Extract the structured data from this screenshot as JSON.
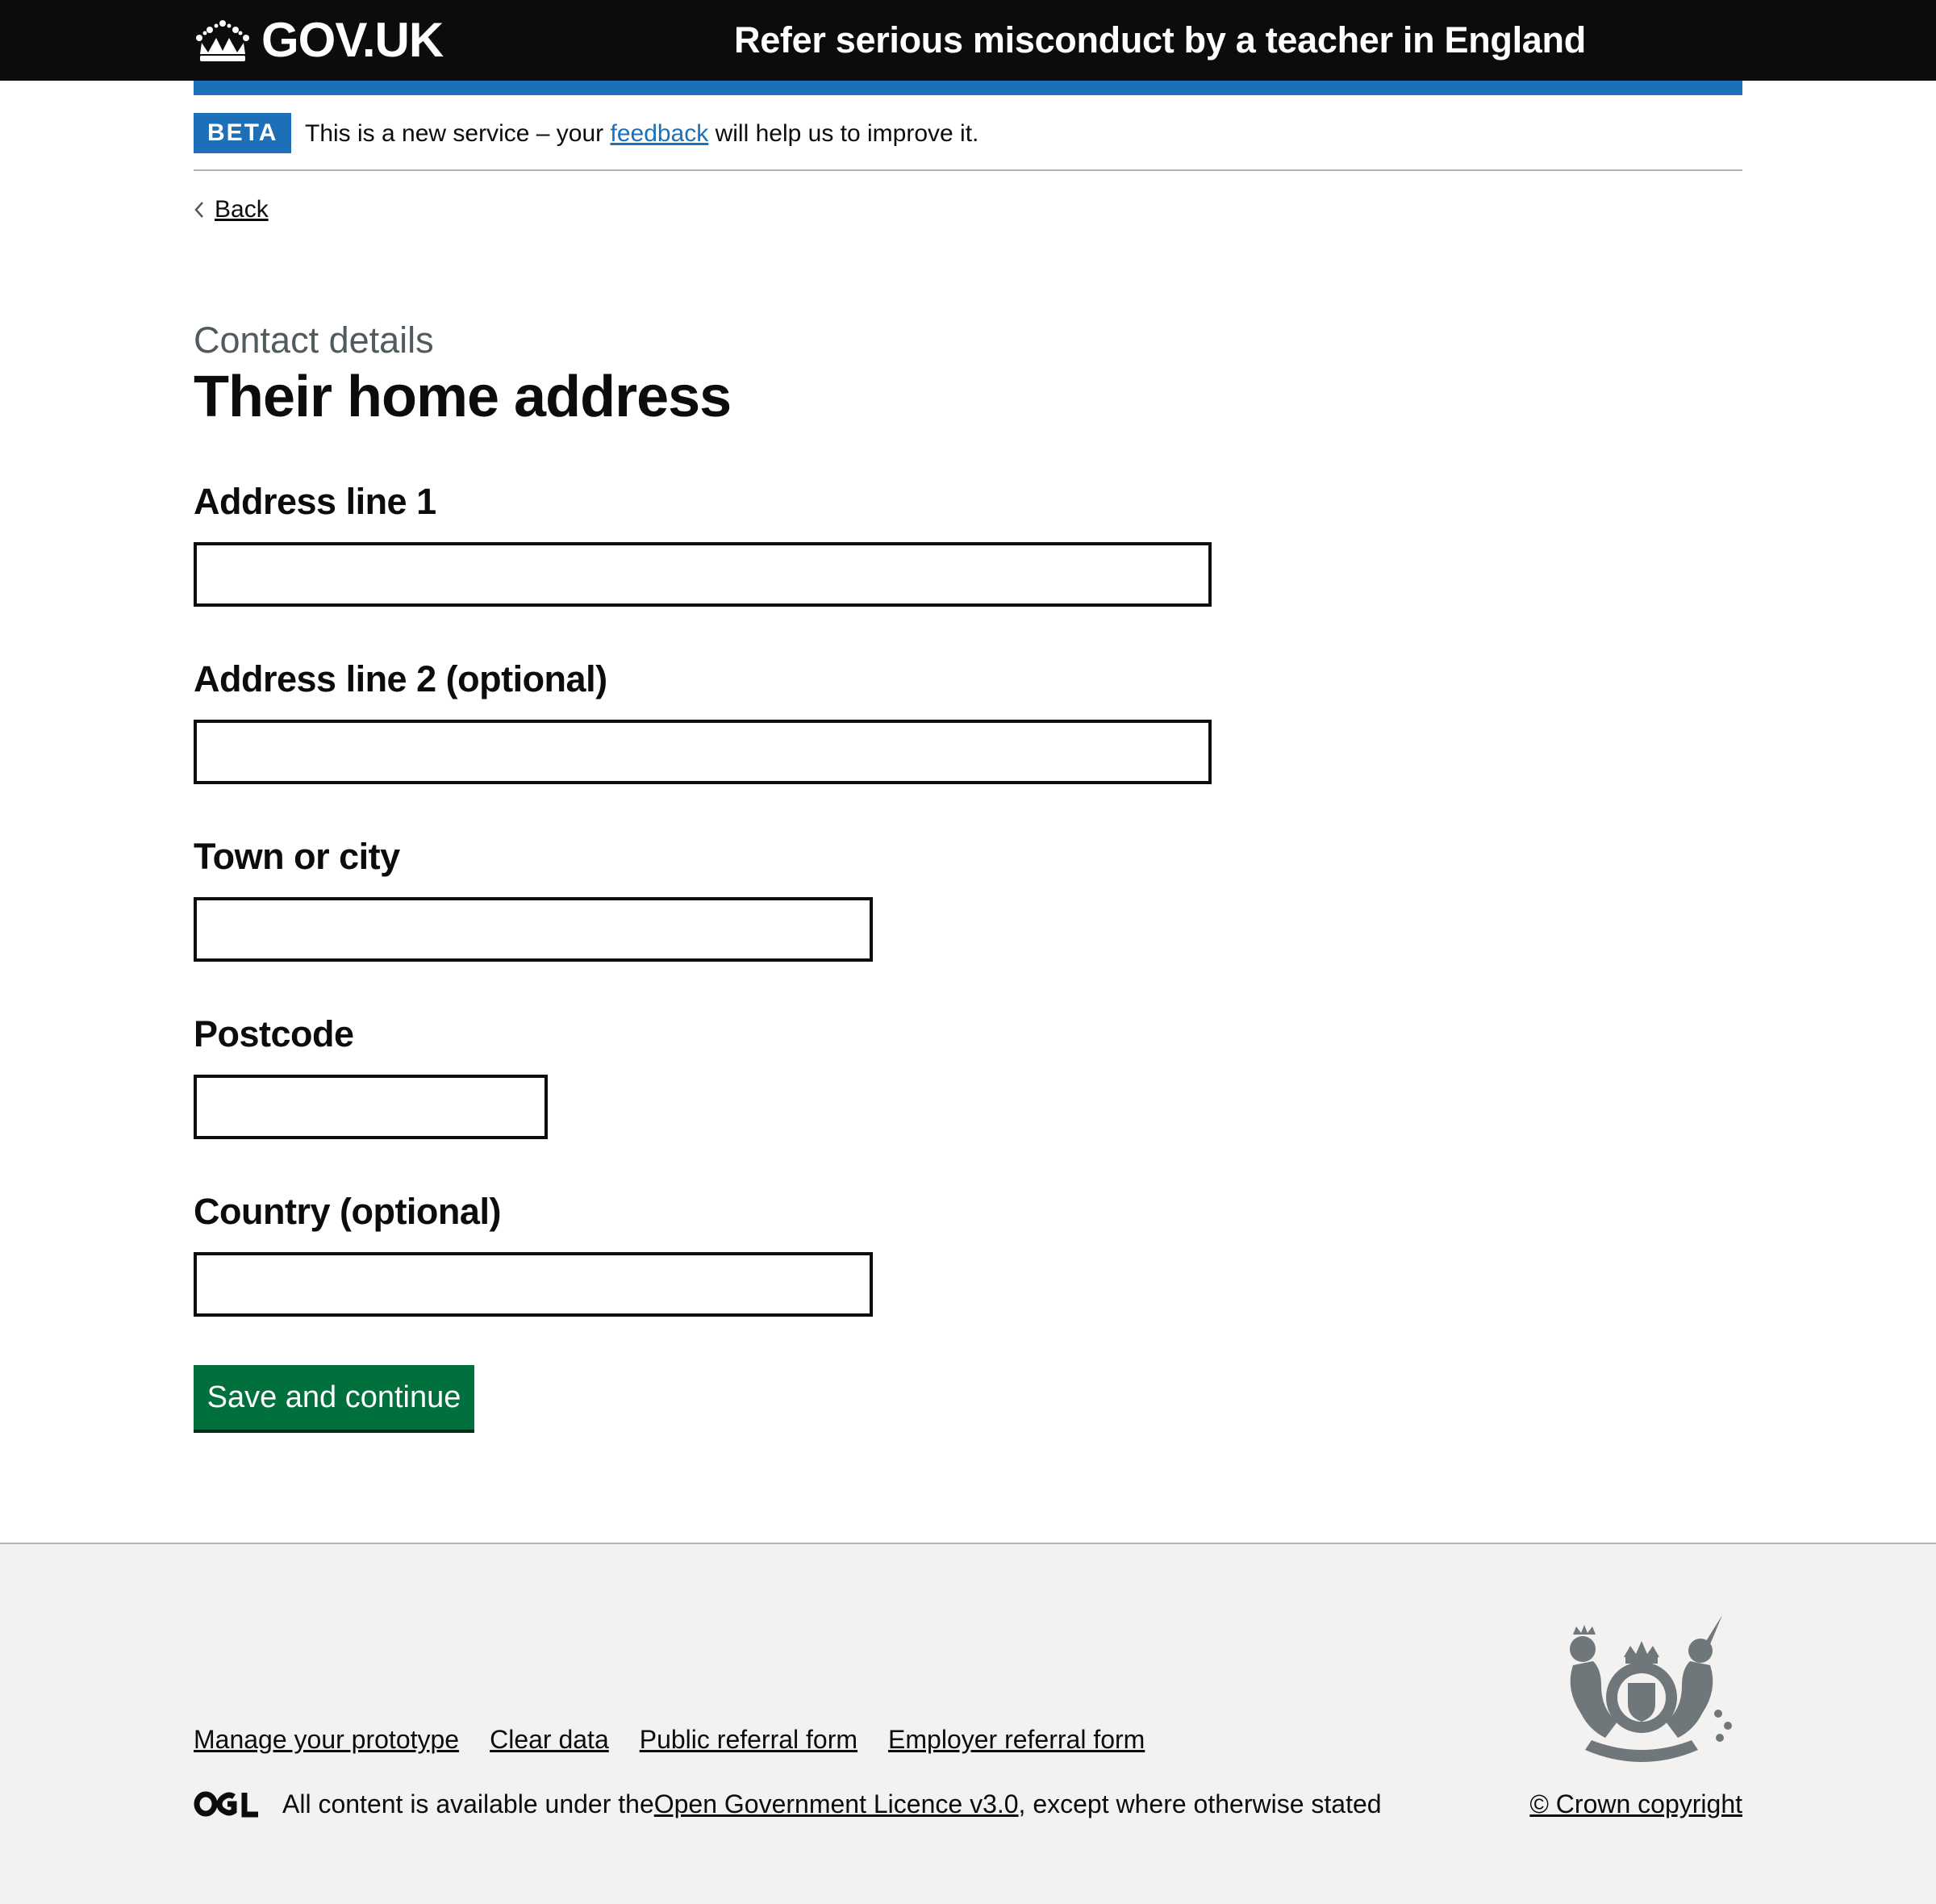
{
  "header": {
    "logotype": "GOV.UK",
    "service_name": "Refer serious misconduct by a teacher in England"
  },
  "phase_banner": {
    "tag": "BETA",
    "text_before": "This is a new service – your ",
    "link": "feedback",
    "text_after": " will help us to improve it."
  },
  "back_link": "Back",
  "page": {
    "caption": "Contact details",
    "title": "Their home address"
  },
  "form": {
    "address_line_1": {
      "label": "Address line 1",
      "value": ""
    },
    "address_line_2": {
      "label": "Address line 2 (optional)",
      "value": ""
    },
    "town": {
      "label": "Town or city",
      "value": ""
    },
    "postcode": {
      "label": "Postcode",
      "value": ""
    },
    "country": {
      "label": "Country (optional)",
      "value": ""
    },
    "submit_label": "Save and continue"
  },
  "footer": {
    "links": [
      "Manage your prototype",
      "Clear data",
      "Public referral form",
      "Employer referral form"
    ],
    "licence_before": "All content is available under the ",
    "licence_link": "Open Government Licence v3.0",
    "licence_after": ", except where otherwise stated",
    "copyright": "© Crown copyright"
  },
  "colors": {
    "header_bg": "#0b0c0c",
    "brand_blue": "#1d70b8",
    "button_green": "#00703c",
    "footer_bg": "#f3f2f1",
    "secondary_text": "#505a5f"
  }
}
